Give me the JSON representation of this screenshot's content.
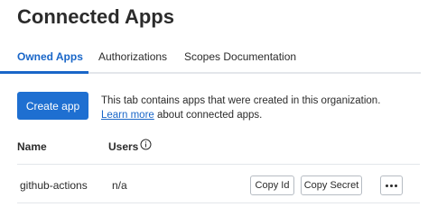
{
  "page": {
    "title": "Connected Apps"
  },
  "tabs": [
    {
      "label": "Owned Apps",
      "active": true
    },
    {
      "label": "Authorizations",
      "active": false
    },
    {
      "label": "Scopes Documentation",
      "active": false
    }
  ],
  "actions": {
    "create_label": "Create app"
  },
  "info": {
    "prefix": "This tab contains apps that were created in this organization. ",
    "link": "Learn more",
    "suffix": " about connected apps."
  },
  "table": {
    "columns": {
      "name": "Name",
      "users": "Users"
    },
    "rows": [
      {
        "name": "github-actions",
        "users": "n/a",
        "copy_id_label": "Copy Id",
        "copy_secret_label": "Copy Secret"
      }
    ]
  },
  "icons": {
    "users_info": "info-circle-icon",
    "row_menu": "more-horizontal-icon"
  },
  "colors": {
    "accent": "#1966c8",
    "button": "#1e6fd1",
    "divider": "#e3e6ea"
  }
}
